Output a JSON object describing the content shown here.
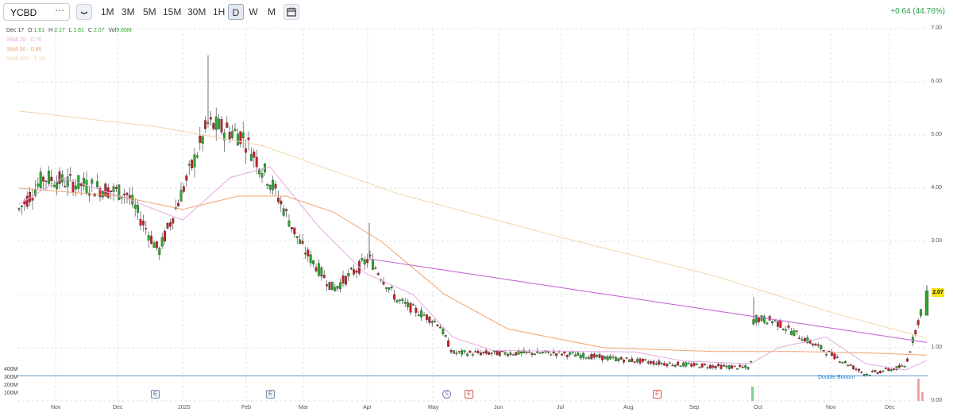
{
  "toolbar": {
    "ticker": "YCBD",
    "more_icon": "ellipsis-icon",
    "chart_type_icon": "candlestick-icon",
    "periods": [
      "1M",
      "3M",
      "5M",
      "15M",
      "30M",
      "1H",
      "D",
      "W",
      "M"
    ],
    "active_period": "D",
    "calendar_icon": "calendar-icon",
    "change_text": "+0.64 (44.76%)"
  },
  "legend": {
    "date": "Dec 17",
    "o_label": "O",
    "o_value": "1.61",
    "h_label": "H",
    "h_value": "2.17",
    "l_label": "L",
    "l_value": "1.61",
    "c_label": "C",
    "c_value": "2.07",
    "vol_label": "Vol",
    "vol_value": "9.66M",
    "sma20": "SMA 20 · 0.76",
    "sma50": "SMA 50 · 0.86",
    "sma200": "SMA 200 · 1.18"
  },
  "colors": {
    "up": "#2ca82c",
    "down": "#c8202a",
    "sma20": "#e7a8e3",
    "sma50": "#f0a470",
    "sma200": "#f2d3a8",
    "trendline": "#c36bd1",
    "support": "#2e7fc9",
    "grid": "#d8d8d8"
  },
  "price_tag": "2.07",
  "events": [
    {
      "label": "E",
      "style": "E"
    },
    {
      "label": "E",
      "style": "E"
    },
    {
      "label": "S",
      "style": "S"
    },
    {
      "label": "E",
      "style": "E-red"
    },
    {
      "label": "E",
      "style": "E-red"
    },
    {
      "label": "E",
      "style": "E-red"
    }
  ],
  "pattern_label": "Double Bottom",
  "chart_data": {
    "type": "candlestick",
    "y_axis": {
      "min": 0,
      "max": 7,
      "ticks": [
        "0.00",
        "1.00",
        "2.00",
        "3.00",
        "4.00",
        "5.00",
        "6.00",
        "7.00"
      ],
      "position": "right"
    },
    "volume_axis": {
      "ticks": [
        "400M",
        "300M",
        "200M",
        "100M"
      ]
    },
    "x_ticks": [
      "Nov",
      "Dec",
      "2025",
      "Feb",
      "Mar",
      "Apr",
      "May",
      "Jun",
      "Jul",
      "Aug",
      "Sep",
      "Oct",
      "Nov",
      "Dec"
    ],
    "grid": true,
    "key_points": [
      {
        "period": "Oct 2024",
        "close": 3.6
      },
      {
        "period": "early Nov 2024",
        "close": 4.2
      },
      {
        "period": "mid Dec 2024",
        "close": 3.9
      },
      {
        "period": "late Dec 2024",
        "close": 2.8
      },
      {
        "period": "Jan 2025 high",
        "high": 6.5
      },
      {
        "period": "early Feb 2025",
        "close": 5.0
      },
      {
        "period": "mid Feb 2025",
        "close": 4.0
      },
      {
        "period": "early Mar 2025",
        "close": 2.9
      },
      {
        "period": "mid Mar 2025",
        "close": 2.1
      },
      {
        "period": "early Apr 2025",
        "high": 3.35
      },
      {
        "period": "mid Apr 2025",
        "close": 1.9
      },
      {
        "period": "early May 2025",
        "close": 1.45
      },
      {
        "period": "mid May 2025",
        "close": 0.9
      },
      {
        "period": "Jun-Aug 2025",
        "close": 0.9
      },
      {
        "period": "late Aug 2025",
        "close": 0.7
      },
      {
        "period": "late Sep 2025",
        "close": 0.62
      },
      {
        "period": "late Sep 2025 spike",
        "high": 1.95
      },
      {
        "period": "early Oct 2025",
        "close": 1.5
      },
      {
        "period": "mid Nov 2025",
        "close": 0.5
      },
      {
        "period": "early Dec 2025",
        "close": 0.65
      },
      {
        "period": "Dec 17 2025",
        "open": 1.61,
        "high": 2.17,
        "low": 1.61,
        "close": 2.07
      }
    ],
    "sma20_last": 0.76,
    "sma50_last": 0.86,
    "sma200_last": 1.18
  }
}
